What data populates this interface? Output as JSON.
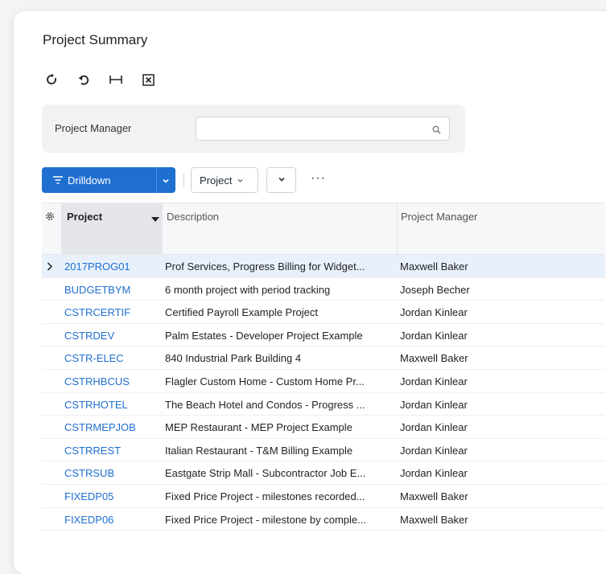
{
  "page": {
    "title": "Project Summary"
  },
  "toolbar": {
    "icons": [
      "refresh-icon",
      "undo-icon",
      "fit-columns-icon",
      "excel-export-icon"
    ]
  },
  "filter": {
    "label": "Project Manager",
    "value": "",
    "placeholder": ""
  },
  "actions": {
    "drilldown_label": "Drilldown",
    "project_label": "Project",
    "more": "···"
  },
  "table": {
    "columns": [
      "Project",
      "Description",
      "Project Manager"
    ],
    "rows": [
      {
        "id": "2017PROG01",
        "description": "Prof Services, Progress Billing for Widget...",
        "manager": "Maxwell Baker",
        "selected": true
      },
      {
        "id": "BUDGETBYM",
        "description": "6 month project with period tracking",
        "manager": "Joseph Becher"
      },
      {
        "id": "CSTRCERTIF",
        "description": "Certified Payroll Example Project",
        "manager": "Jordan Kinlear"
      },
      {
        "id": "CSTRDEV",
        "description": "Palm Estates - Developer Project Example",
        "manager": "Jordan Kinlear"
      },
      {
        "id": "CSTR-ELEC",
        "description": "840 Industrial Park Building 4",
        "manager": "Maxwell Baker"
      },
      {
        "id": "CSTRHBCUS",
        "description": "Flagler Custom Home - Custom Home Pr...",
        "manager": "Jordan Kinlear"
      },
      {
        "id": "CSTRHOTEL",
        "description": "The Beach Hotel and Condos - Progress ...",
        "manager": "Jordan Kinlear"
      },
      {
        "id": "CSTRMEPJOB",
        "description": "MEP Restaurant - MEP Project Example",
        "manager": "Jordan Kinlear"
      },
      {
        "id": "CSTRREST",
        "description": "Italian Restaurant - T&M Billing Example",
        "manager": "Jordan Kinlear"
      },
      {
        "id": "CSTRSUB",
        "description": "Eastgate Strip Mall - Subcontractor Job E...",
        "manager": "Jordan Kinlear"
      },
      {
        "id": "FIXEDP05",
        "description": "Fixed Price Project - milestones recorded...",
        "manager": "Maxwell Baker"
      },
      {
        "id": "FIXEDP06",
        "description": "Fixed Price Project - milestone by comple...",
        "manager": "Maxwell Baker"
      }
    ]
  },
  "colors": {
    "accent": "#1f6fd1",
    "selected_row": "#e8f1fb"
  }
}
